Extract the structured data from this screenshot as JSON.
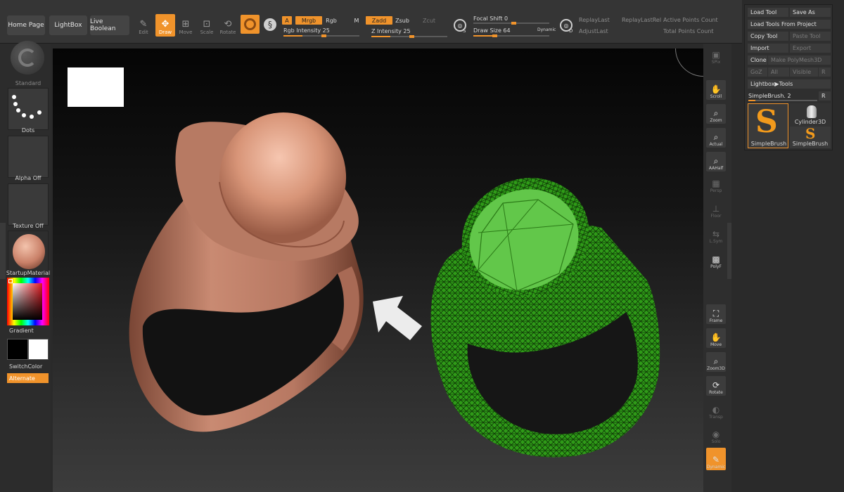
{
  "header": {
    "home_page": "Home Page",
    "lightbox": "LightBox",
    "live_boolean": "Live Boolean",
    "tools": [
      {
        "label": "Edit",
        "icon": "edit-icon",
        "active": false
      },
      {
        "label": "Draw",
        "icon": "draw-icon",
        "active": true
      },
      {
        "label": "Move",
        "icon": "move-icon",
        "active": false
      },
      {
        "label": "Scale",
        "icon": "scale-icon",
        "active": false
      },
      {
        "label": "Rotate",
        "icon": "rotate-icon",
        "active": false
      }
    ],
    "a_button": "A",
    "mrgb": "Mrgb",
    "rgb": "Rgb",
    "m": "M",
    "zadd": "Zadd",
    "zsub": "Zsub",
    "zcut": "Zcut",
    "rgb_intensity": "Rgb Intensity 25",
    "z_intensity": "Z Intensity 25",
    "focal_shift": "Focal Shift 0",
    "draw_size": "Draw Size 64",
    "dynamic": "Dynamic",
    "replay_last": "ReplayLast",
    "replay_last_rel": "ReplayLastRel",
    "adjust_last": "AdjustLast",
    "active_points": "Active Points Count",
    "total_points": "Total Points Count",
    "s_badge": "S",
    "d_badge": "D"
  },
  "left_panel": {
    "brush_label": "Standard",
    "stroke_label": "Dots",
    "alpha_label": "Alpha Off",
    "texture_label": "Texture Off",
    "material_label": "StartupMaterial",
    "gradient_label": "Gradient",
    "switchcolor_label": "SwitchColor",
    "alternate_label": "Alternate"
  },
  "right_shelf": {
    "items": [
      {
        "label": "SPix",
        "icon": "bpr-icon",
        "dim": true
      },
      {
        "label": "Scroll",
        "icon": "scroll-hand-icon",
        "dim": false
      },
      {
        "label": "Zoom",
        "icon": "zoom-icon",
        "dim": false
      },
      {
        "label": "Actual",
        "icon": "actual-icon",
        "dim": false
      },
      {
        "label": "AAHalf",
        "icon": "aahalf-icon",
        "dim": false
      },
      {
        "label": "Persp",
        "icon": "persp-icon",
        "dim": true
      },
      {
        "label": "Floor",
        "icon": "floor-icon",
        "dim": true
      },
      {
        "label": "L.Sym",
        "icon": "lsym-icon",
        "dim": true
      },
      {
        "label": "PolyF",
        "icon": "polyf-icon",
        "dim": false
      },
      {
        "label": "Frame",
        "icon": "frame-icon",
        "dim": false
      },
      {
        "label": "Move",
        "icon": "move-hand-icon",
        "dim": false
      },
      {
        "label": "Zoom3D",
        "icon": "zoom3d-icon",
        "dim": false
      },
      {
        "label": "Rotate",
        "icon": "rotate3d-icon",
        "dim": false
      },
      {
        "label": "Transp",
        "icon": "transp-icon",
        "dim": true
      },
      {
        "label": "Solo",
        "icon": "solo-icon",
        "dim": true
      },
      {
        "label": "Dynamic",
        "icon": "dynamic-icon",
        "dim": false
      }
    ]
  },
  "tool_panel": {
    "load_tool": "Load Tool",
    "save_as": "Save As",
    "load_from_project": "Load Tools From Project",
    "copy_tool": "Copy Tool",
    "paste_tool": "Paste Tool",
    "import": "Import",
    "export": "Export",
    "clone": "Clone",
    "make_polymesh": "Make PolyMesh3D",
    "goz": "GoZ",
    "all": "All",
    "visible": "Visible",
    "r": "R",
    "lightbox_tools": "Lightbox▶Tools",
    "simplebrush_slider": "SimpleBrush. 2",
    "r2": "R",
    "thumb1_label": "SimpleBrush",
    "thumb2_top_label": "Cylinder3D",
    "thumb2_label": "SimpleBrush"
  },
  "colors": {
    "accent": "#f0932b",
    "ring_left": "#c98a72",
    "ring_right": "#3aa51f"
  }
}
